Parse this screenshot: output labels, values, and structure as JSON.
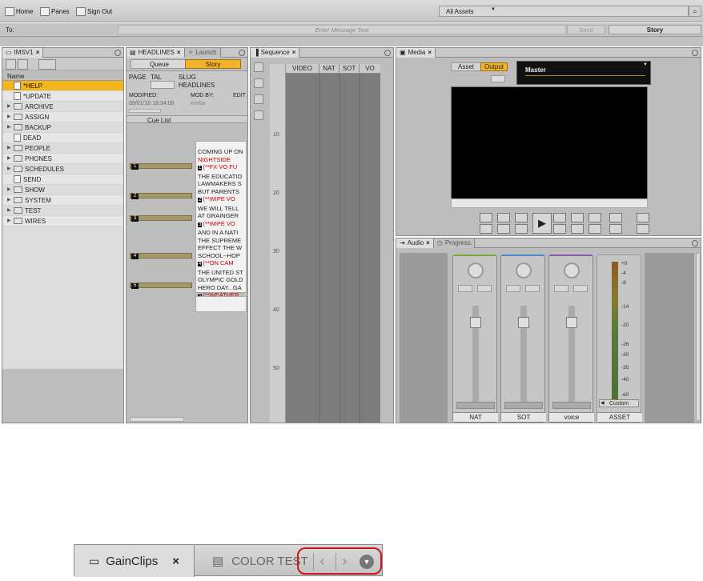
{
  "toolbar": {
    "home": "Home",
    "panes": "Panes",
    "signout": "Sign Out",
    "assets": "All Assets"
  },
  "message": {
    "to": "To:",
    "placeholder": "Enter Message Text",
    "send": "Send",
    "story": "Story"
  },
  "tree": {
    "tab": "IMSV1",
    "header": "Name",
    "items": [
      {
        "label": "*HELP",
        "kind": "doc",
        "selected": true
      },
      {
        "label": "*UPDATE",
        "kind": "doc"
      },
      {
        "label": "ARCHIVE",
        "kind": "folder"
      },
      {
        "label": "ASSIGN",
        "kind": "folder"
      },
      {
        "label": "BACKUP",
        "kind": "folder"
      },
      {
        "label": "DEAD",
        "kind": "doc"
      },
      {
        "label": "PEOPLE",
        "kind": "folder"
      },
      {
        "label": "PHONES",
        "kind": "folder"
      },
      {
        "label": "SCHEDULES",
        "kind": "folder"
      },
      {
        "label": "SEND",
        "kind": "doc"
      },
      {
        "label": "SHOW",
        "kind": "folder"
      },
      {
        "label": "SYSTEM",
        "kind": "folder"
      },
      {
        "label": "TEST",
        "kind": "folder"
      },
      {
        "label": "WIRES",
        "kind": "folder"
      }
    ]
  },
  "headlines": {
    "tab": "HEADLINES",
    "tab2": "Launch",
    "queue": "Queue",
    "story": "Story",
    "page": "PAGE",
    "tal": "TAL",
    "slug": "SLUG",
    "slug_value": "HEADLINES",
    "modified": "MODIFIED:",
    "mod_by": "MOD BY:",
    "edit": "EDIT",
    "mod_date": "09/01/10 18:34:06",
    "mod_user": "evelar",
    "cue_list": "Cue List",
    "cues": [
      "1",
      "2",
      "3",
      "4",
      "5"
    ],
    "lines": [
      {
        "t": "COMING UP ON",
        "c": ""
      },
      {
        "t": "NIGHTSIDE",
        "c": "red"
      },
      {
        "n": "1",
        "t": "(**FX VO FU",
        "c": "red"
      },
      {
        "t": "THE EDUCATIO",
        "c": ""
      },
      {
        "t": "LAWMAKERS S",
        "c": ""
      },
      {
        "t": "BUT PARENTS",
        "c": ""
      },
      {
        "n": "2",
        "t": "(**WIPE VO",
        "c": "red"
      },
      {
        "t": "WE WILL TELL",
        "c": ""
      },
      {
        "t": "AT GRAINGER",
        "c": ""
      },
      {
        "n": "3",
        "t": "(**WIPE VO",
        "c": "red"
      },
      {
        "t": "AND IN A NATI",
        "c": ""
      },
      {
        "t": "THE SUPREME",
        "c": ""
      },
      {
        "t": "EFFECT THE W",
        "c": ""
      },
      {
        "t": "SCHOOL--HOP",
        "c": ""
      },
      {
        "n": "4",
        "t": "(**ON CAM",
        "c": "red"
      },
      {
        "t": "THE UNITED ST",
        "c": ""
      },
      {
        "t": "OLYMPIC GOLD",
        "c": ""
      },
      {
        "t": "HERO DAY...GA",
        "c": ""
      },
      {
        "n": "5",
        "t": "(**WEATHER",
        "c": "red"
      }
    ]
  },
  "sequence": {
    "tab": "Sequence",
    "cols": [
      "VIDEO",
      "NAT",
      "SOT",
      "VO"
    ],
    "ticks": [
      "10",
      "20",
      "30",
      "40",
      "50"
    ]
  },
  "media": {
    "tab": "Media",
    "asset": "Asset",
    "output": "Output",
    "master": "Master"
  },
  "audio": {
    "tab": "Audio",
    "tab2": "Progress",
    "channels": [
      "NAT",
      "SOT",
      "voice"
    ],
    "asset": "ASSET",
    "custom": "Custom",
    "meter_labels": [
      "+0",
      "-4",
      "-8",
      "-14",
      "-20",
      "-26",
      "-30",
      "-35",
      "-40",
      "-60"
    ]
  },
  "zoom": {
    "tab": "GainClips",
    "tab2": "COLOR TEST"
  }
}
